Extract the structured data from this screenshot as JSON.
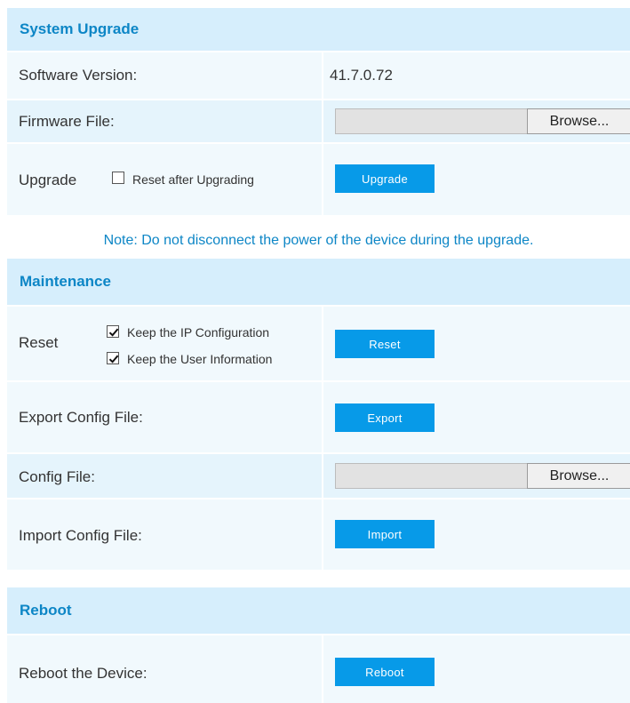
{
  "system_upgrade": {
    "title": "System Upgrade",
    "software_version_label": "Software Version:",
    "software_version_value": "41.7.0.72",
    "firmware_file_label": "Firmware File:",
    "browse_label": "Browse...",
    "upgrade_label": "Upgrade",
    "reset_after_upgrading_label": "Reset after Upgrading",
    "reset_after_upgrading_checked": false,
    "upgrade_button": "Upgrade"
  },
  "note": "Note: Do not disconnect the power of the device during the upgrade.",
  "maintenance": {
    "title": "Maintenance",
    "reset_label": "Reset",
    "keep_ip_label": "Keep the IP Configuration",
    "keep_ip_checked": true,
    "keep_user_label": "Keep the User Information",
    "keep_user_checked": true,
    "reset_button": "Reset",
    "export_label": "Export Config File:",
    "export_button": "Export",
    "config_file_label": "Config File:",
    "browse_label": "Browse...",
    "import_label": "Import Config File:",
    "import_button": "Import"
  },
  "reboot": {
    "title": "Reboot",
    "reboot_label": "Reboot the Device:",
    "reboot_button": "Reboot"
  },
  "colors": {
    "accent": "#079ae8",
    "header_bg": "#d6eefc",
    "header_text": "#0d86c6"
  }
}
